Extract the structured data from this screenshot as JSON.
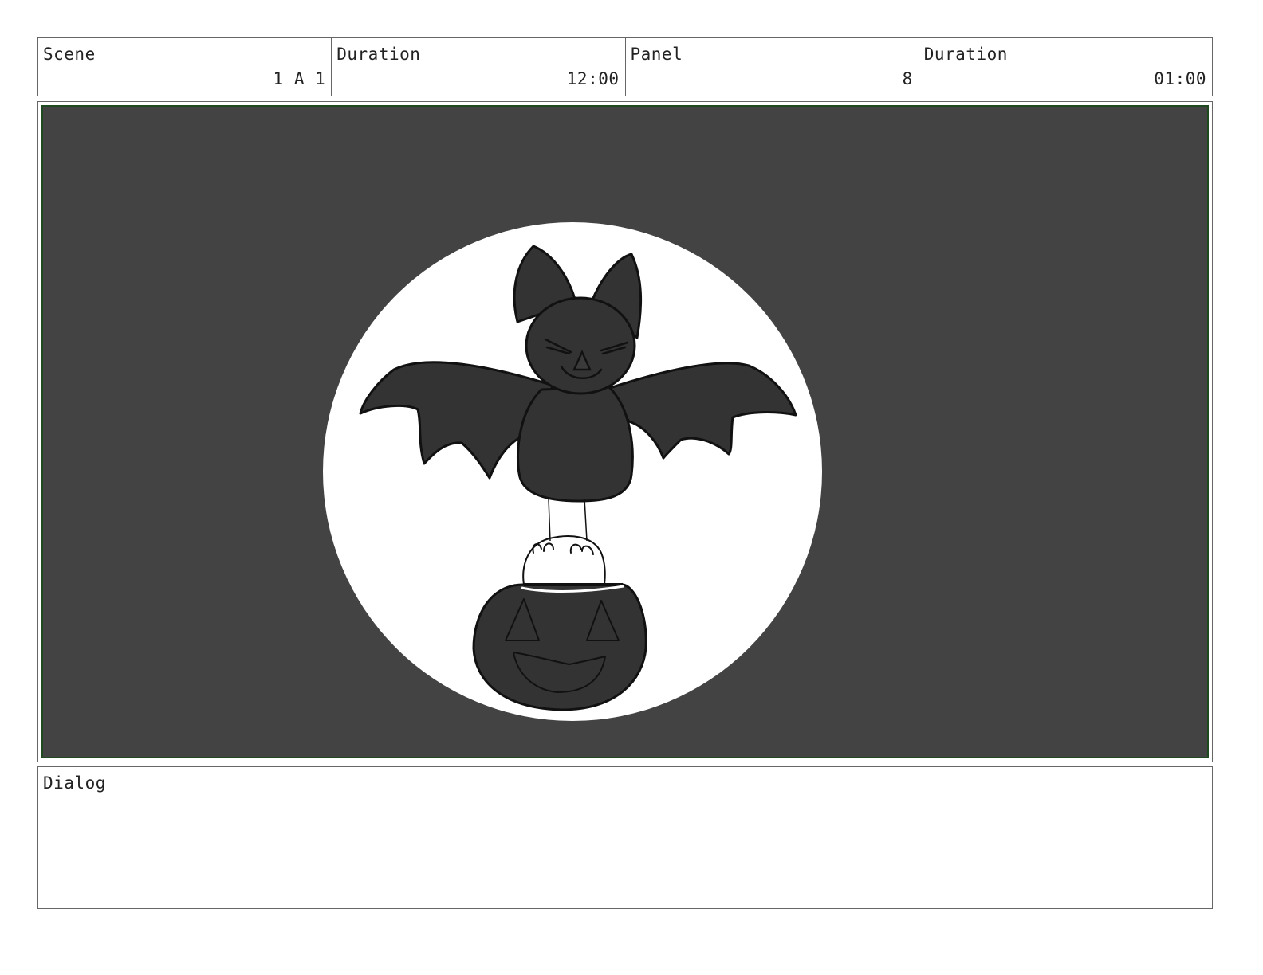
{
  "header": {
    "scene_label": "Scene",
    "scene_value": "1_A_1",
    "scene_duration_label": "Duration",
    "scene_duration_value": "12:00",
    "panel_label": "Panel",
    "panel_value": "8",
    "panel_duration_label": "Duration",
    "panel_duration_value": "01:00"
  },
  "dialog": {
    "label": "Dialog",
    "text": ""
  },
  "colors": {
    "panel_background": "#434343",
    "moon": "#ffffff",
    "bat": "#333333",
    "outline": "#111111",
    "frame_border": "#1f4a1f"
  }
}
